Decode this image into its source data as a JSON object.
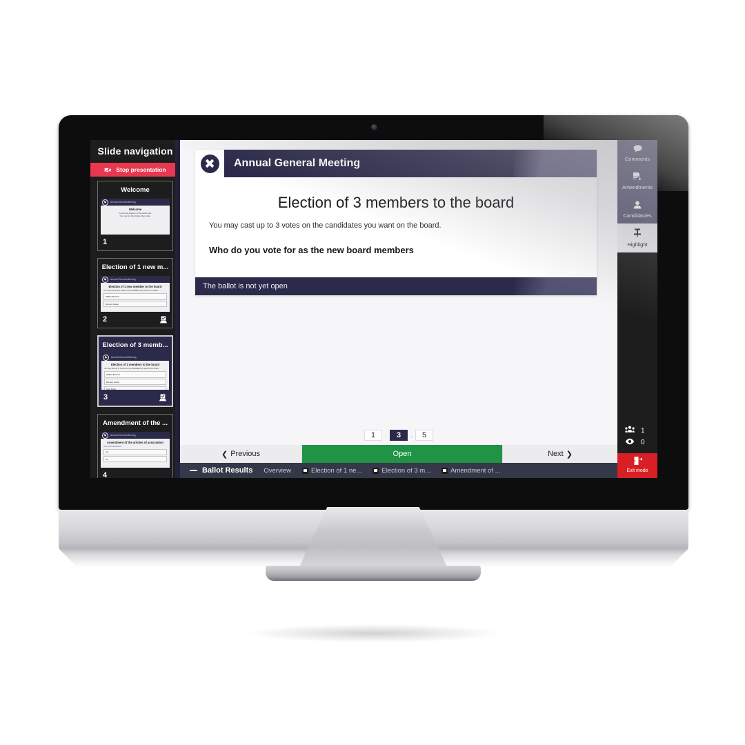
{
  "sidebar": {
    "title": "Slide navigation",
    "stop_button": {
      "label": "Stop presentation",
      "icon": "camera-off-icon",
      "color": "#e8384f"
    },
    "slides": [
      {
        "title": "Welcome",
        "number": "1",
        "active": false,
        "has_ballot_icon": false,
        "mini": {
          "header": "Annual General Meeting",
          "title": "Welcome",
          "lines": [
            "You are now logged in to the election site.",
            "You must turn the window when voting."
          ],
          "options": [],
          "link": ""
        }
      },
      {
        "title": "Election of 1 new m...",
        "number": "2",
        "active": false,
        "has_ballot_icon": true,
        "mini": {
          "header": "Annual General Meeting",
          "title": "Election of 1 new member to the board",
          "lines": [
            "You may cast up to 1 ballot on the candidates you want on the board."
          ],
          "options": [
            "William Bostock",
            "Bernard Fowler"
          ],
          "link": ""
        }
      },
      {
        "title": "Election of 3 memb...",
        "number": "3",
        "active": true,
        "has_ballot_icon": true,
        "mini": {
          "header": "Annual General Meeting",
          "title": "Election of 3 members to the board",
          "lines": [
            "You may cast up to 3 votes on the candidates you want on the board."
          ],
          "options": [
            "William Bostock",
            "Bernard Fowler",
            "Tony Smith"
          ],
          "link": ""
        }
      },
      {
        "title": "Amendment of the ...",
        "number": "4",
        "active": false,
        "has_ballot_icon": false,
        "mini": {
          "header": "Annual General Meeting",
          "title": "Amendment of the articles of association",
          "lines": [],
          "options": [
            "Yes",
            "No"
          ],
          "link": "Link to full amendment"
        }
      }
    ]
  },
  "slide": {
    "header_title": "Annual General Meeting",
    "logo_icon": "x-mark-logo-icon",
    "title": "Election of 3 members to the board",
    "description": "You may cast up to 3 votes on the candidates you want on the board.",
    "question": "Who do you vote for as the new board members",
    "ballot_status": "The ballot is not yet open"
  },
  "pagination": {
    "pages": [
      "1",
      "3",
      "5"
    ],
    "active": "3",
    "ellipsis": "."
  },
  "controls": {
    "previous": "Previous",
    "previous_icon": "chevron-left-icon",
    "open": "Open",
    "next": "Next",
    "next_icon": "chevron-right-icon",
    "open_color": "#219344"
  },
  "results_bar": {
    "title": "Ballot Results",
    "collapse_icon": "minus-icon",
    "tabs": [
      {
        "label": "Overview",
        "has_icon": false
      },
      {
        "label": "Election of 1 ne...",
        "has_icon": true
      },
      {
        "label": "Election of 3 m...",
        "has_icon": true
      },
      {
        "label": "Amendment of ...",
        "has_icon": true
      }
    ]
  },
  "right_rail": {
    "items": [
      {
        "label": "Comments",
        "icon": "comment-bubble-icon",
        "highlighted": false
      },
      {
        "label": "Amendments",
        "icon": "document-edit-icon",
        "highlighted": false
      },
      {
        "label": "Candidacies",
        "icon": "person-icon",
        "highlighted": false
      },
      {
        "label": "Highlight",
        "icon": "pin-icon",
        "highlighted": true
      }
    ],
    "counts": [
      {
        "icon": "attendees-icon",
        "value": "1"
      },
      {
        "icon": "eye-icon",
        "value": "0"
      }
    ],
    "exit": {
      "label": "Exit mode",
      "icon": "exit-door-icon",
      "color": "#d81f26"
    }
  }
}
